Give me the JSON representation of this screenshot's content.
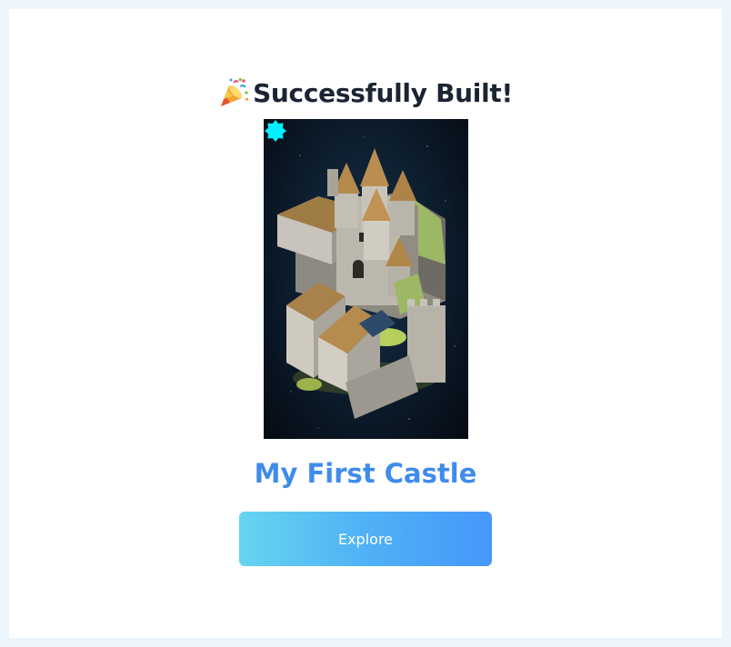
{
  "dialog": {
    "title": "Successfully Built!",
    "title_icon": "party-popper-icon",
    "castle_name": "My First Castle",
    "explore_label": "Explore",
    "badge_icon": "cyan-star-badge-icon"
  },
  "colors": {
    "page_background": "#ecf4fc",
    "card_background": "#ffffff",
    "title_text": "#1b2433",
    "castle_name_text": "#3f8ceb",
    "button_gradient_start": "#66d5f0",
    "button_gradient_end": "#4697fa",
    "badge": "#00f0ff"
  }
}
